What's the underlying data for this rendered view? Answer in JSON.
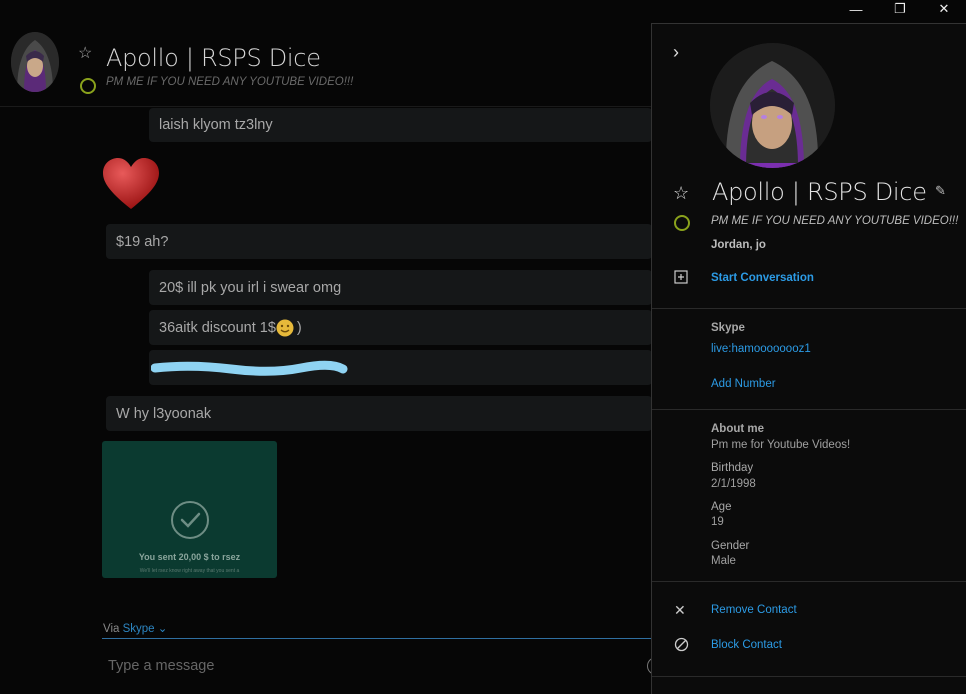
{
  "window": {
    "minimize": "—",
    "restore": "❐",
    "close": "✕"
  },
  "contact": {
    "name": "Apollo | RSPS Dice",
    "status": "PM ME IF YOU NEED ANY YOUTUBE VIDEO!!!"
  },
  "messages": [
    {
      "text": "laish klyom tz3lny"
    },
    {
      "text": "$19 ah?"
    },
    {
      "text": "20$ ill pk you irl i swear omg"
    },
    {
      "text": "36aitk discount 1$ ",
      "suffix": ")"
    },
    {
      "text": ""
    },
    {
      "text": "W hy l3yoonak"
    }
  ],
  "payment": {
    "title": "You sent 20,00 $ to rsez",
    "subtitle": "We'll let rsez know right away that you sent a"
  },
  "via": {
    "prefix": "Via ",
    "service": "Skype",
    "chevron": "⌄"
  },
  "compose": {
    "placeholder": "Type a message"
  },
  "panel": {
    "mutual": "Jordan, jo",
    "start_conversation": "Start Conversation",
    "skype_label": "Skype",
    "skype_id": "live:hamoooooooz1",
    "add_number": "Add Number",
    "about_label": "About me",
    "about_value": "Pm me for Youtube Videos!",
    "birthday_label": "Birthday",
    "birthday_value": "2/1/1998",
    "age_label": "Age",
    "age_value": "19",
    "gender_label": "Gender",
    "gender_value": "Male",
    "remove_contact": "Remove Contact",
    "block_contact": "Block Contact"
  },
  "colors": {
    "accent": "#2c9be5",
    "presence": "#8aa21c",
    "bubble": "#151718",
    "panel": "#0b0b0b"
  }
}
